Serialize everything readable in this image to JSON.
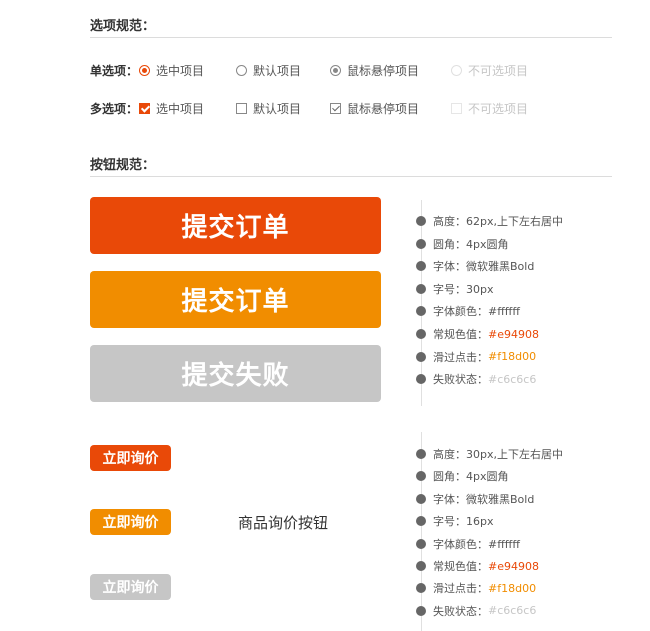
{
  "options_section": {
    "title": "选项规范：",
    "radio_row": {
      "label": "单选项：",
      "items": [
        {
          "label": "选中项目",
          "state": "checked"
        },
        {
          "label": "默认项目",
          "state": "default"
        },
        {
          "label": "鼠标悬停项目",
          "state": "hover"
        },
        {
          "label": "不可选项目",
          "state": "disabled"
        }
      ]
    },
    "checkbox_row": {
      "label": "多选项：",
      "items": [
        {
          "label": "选中项目",
          "state": "checked"
        },
        {
          "label": "默认项目",
          "state": "default"
        },
        {
          "label": "鼠标悬停项目",
          "state": "hover"
        },
        {
          "label": "不可选项目",
          "state": "disabled"
        }
      ]
    }
  },
  "buttons_section": {
    "title": "按钮规范：",
    "big_buttons": [
      {
        "label": "提交订单",
        "color": "#e94908"
      },
      {
        "label": "提交订单",
        "color": "#f18d00"
      },
      {
        "label": "提交失败",
        "color": "#c6c6c6"
      }
    ],
    "big_specs": [
      {
        "text": "高度：62px,上下左右居中",
        "value": ""
      },
      {
        "text": "圆角：4px圆角",
        "value": ""
      },
      {
        "text": "字体：微软雅黑Bold",
        "value": ""
      },
      {
        "text": "字号：30px",
        "value": ""
      },
      {
        "text": "字体颜色：#ffffff",
        "value": ""
      },
      {
        "text": "常规色值：",
        "value": "#e94908"
      },
      {
        "text": "滑过点击：",
        "value": "#f18d00"
      },
      {
        "text": "失败状态：",
        "value": "#c6c6c6"
      }
    ],
    "small_buttons": [
      {
        "label": "立即询价",
        "color": "#e94908"
      },
      {
        "label": "立即询价",
        "color": "#f18d00"
      },
      {
        "label": "立即询价",
        "color": "#c6c6c6"
      }
    ],
    "small_caption": "商品询价按钮",
    "small_specs": [
      {
        "text": "高度：30px,上下左右居中",
        "value": ""
      },
      {
        "text": "圆角：4px圆角",
        "value": ""
      },
      {
        "text": "字体：微软雅黑Bold",
        "value": ""
      },
      {
        "text": "字号：16px",
        "value": ""
      },
      {
        "text": "字体颜色：#ffffff",
        "value": ""
      },
      {
        "text": "常规色值：",
        "value": "#e94908"
      },
      {
        "text": "滑过点击：",
        "value": "#f18d00"
      },
      {
        "text": "失败状态：",
        "value": "#c6c6c6"
      }
    ]
  }
}
